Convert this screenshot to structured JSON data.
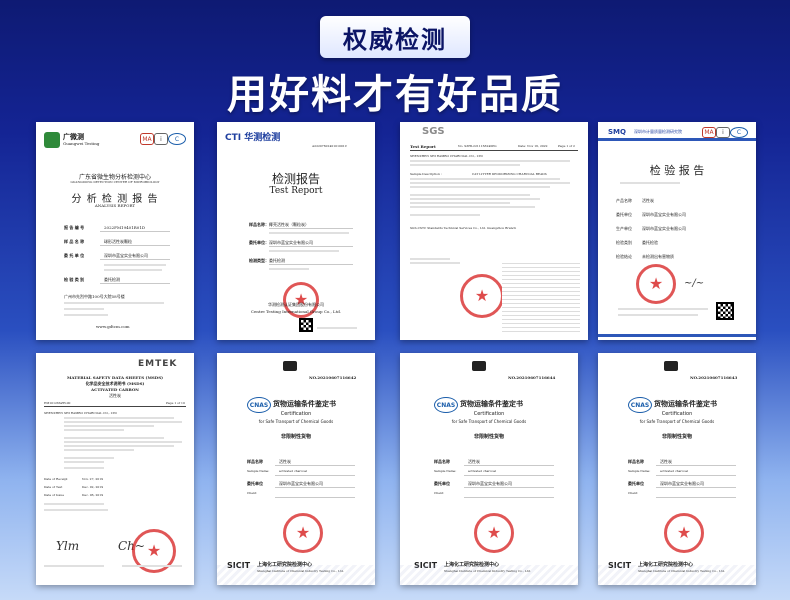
{
  "header": {
    "badge": "权威检测",
    "headline": "用好料才有好品质"
  },
  "colors": {
    "accent": "#142494",
    "stamp": "#d61e1e",
    "card": "#ffffff",
    "cti_brand": "#1f3f9f"
  },
  "card1": {
    "logo_name": "广微测",
    "logo_sub": "Guangwei Testing",
    "org_cn": "广东省微生物分析检测中心",
    "org_en": "GUANGDONG DETECTION CENTER OF MICROBIOLOGY",
    "title_cn": "分 析 检 测 报 告",
    "title_en": "ANALYSIS REPORT",
    "rows": [
      {
        "label": "报 告 编 号",
        "value": "2022FM19401R01D"
      },
      {
        "label": "样 品 名 称",
        "value": "球形活性炭颗粒"
      },
      {
        "label": "委 托 单 位",
        "value": "深圳市蓝宝实业有限公司"
      },
      {
        "label": "检 验 类 别",
        "value": "委托检测"
      }
    ],
    "address": "广州市先烈中路100号大院58号楼",
    "website": "www.gdtcm.com"
  },
  "card2": {
    "brand": "CTI 华测检测",
    "report_no": "A2220760140101001C",
    "title_cn": "检测报告",
    "title_en": "Test Report",
    "rows": [
      {
        "label": "样品名称：",
        "value": "椰壳活性炭（颗粒炭）"
      },
      {
        "label": "委托单位：",
        "value": "深圳市蓝宝实业有限公司"
      },
      {
        "label": "检测类型：",
        "value": "委托检测"
      }
    ],
    "footer_cn": "华测检测认证集团股份有限公司",
    "footer_en": "Centre Testing International Group Co., Ltd."
  },
  "card3": {
    "brand": "SGS",
    "header_left": "Test Report",
    "header_mid": "No. SZHL2211163240PG",
    "header_right": "Date: Nov 16, 2022",
    "page": "Page 1 of 2",
    "client": "SHENZHEN SHI RAMBO CHARCOAL CO., LTD",
    "sample_desc": "CAT LITTER DEODORIZING CHARCOAL BEADS",
    "lab": "SGS-CSTC Standards Technical Services Co., Ltd. Guangzhou Branch"
  },
  "card4": {
    "brand": "SMQ",
    "org": "深圳市计量质量检测研究院",
    "title": "检 验 报 告",
    "rows": [
      {
        "label": "产品名称",
        "value": "活性炭"
      },
      {
        "label": "委托单位",
        "value": "深圳市蓝宝实业有限公司"
      },
      {
        "label": "生产单位",
        "value": "深圳市蓝宝实业有限公司"
      },
      {
        "label": "检验类别",
        "value": "委托检验"
      },
      {
        "label": "检验结论",
        "value": "未检测出有害物质"
      }
    ]
  },
  "card5": {
    "brand": "EMTEK",
    "title_en": "MATERIAL SAFETY DATA SHEETS (MSDS)",
    "title_cn": "化学品安全技术说明书 (MSDS)",
    "product": "ACTIVATED CARBON",
    "subtitle": "活性炭",
    "report_no": "EM10126SZH-00",
    "page": "Page 1 of 10",
    "company": "SHENZHEN SHI RAMBO CHARCOAL CO., LTD",
    "date_received": "Nov. 27, 2019",
    "date_test": "Dec. 02, 2019",
    "date_issue": "Dec. 06, 2019"
  },
  "card6": {
    "report_no": "NO.20210607116642",
    "title_cn": "货物运输条件鉴定书",
    "title_en": "Certification",
    "subtitle_en": "for Safe Transport of Chemical Goods",
    "category": "非限制性货物",
    "sample_name_cn": "活性炭",
    "sample_name_en": "activated charcoal",
    "client": "深圳市蓝宝实业有限公司",
    "footer_logo": "SICIT",
    "footer_cn": "上海化工研究院检测中心",
    "footer_en": "Shanghai Institute of Chemical Industry Testing Co., Ltd."
  },
  "card7": {
    "report_no": "NO.20210607116644",
    "title_cn": "货物运输条件鉴定书",
    "title_en": "Certification",
    "subtitle_en": "for Safe Transport of Chemical Goods",
    "category": "非限制性货物",
    "sample_name_cn": "活性炭",
    "sample_name_en": "activated charcoal",
    "client": "深圳市蓝宝实业有限公司",
    "footer_logo": "SICIT",
    "footer_cn": "上海化工研究院检测中心",
    "footer_en": "Shanghai Institute of Chemical Industry Testing Co., Ltd."
  },
  "card8": {
    "report_no": "NO.20210607116643",
    "title_cn": "货物运输条件鉴定书",
    "title_en": "Certification",
    "subtitle_en": "for Safe Transport of Chemical Goods",
    "category": "非限制性货物",
    "sample_name_cn": "活性炭",
    "sample_name_en": "activated charcoal",
    "client": "深圳市蓝宝实业有限公司",
    "footer_logo": "SICIT",
    "footer_cn": "上海化工研究院检测中心",
    "footer_en": "Shanghai Institute of Chemical Industry Testing Co., Ltd."
  }
}
